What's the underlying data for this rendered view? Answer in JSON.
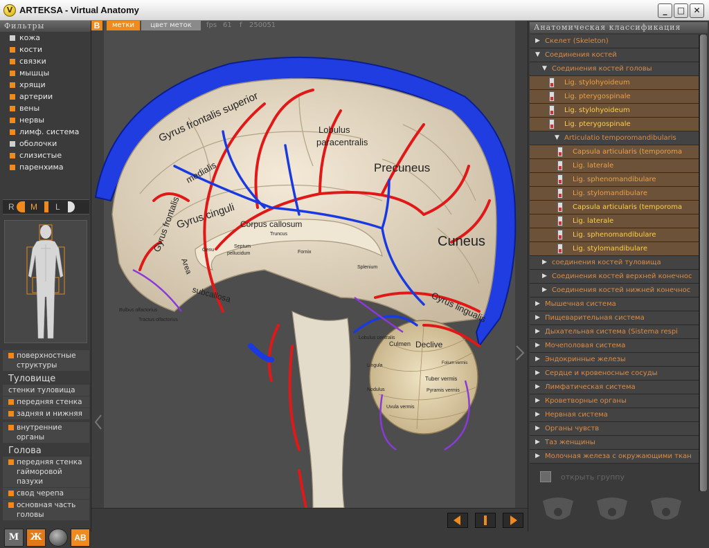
{
  "window": {
    "title": "ARTEKSA - Virtual Anatomy",
    "app_icon_glyph": "V",
    "buttons": {
      "minimize": "_",
      "maximize": "□",
      "close": "✕"
    }
  },
  "left": {
    "filters_header": "Фильтры",
    "filters": [
      {
        "label": "кожа",
        "color": "#cfcfcf"
      },
      {
        "label": "кости",
        "color": "#f08a1c"
      },
      {
        "label": "связки",
        "color": "#f08a1c"
      },
      {
        "label": "мышцы",
        "color": "#f08a1c"
      },
      {
        "label": "хрящи",
        "color": "#f08a1c"
      },
      {
        "label": "артерии",
        "color": "#f08a1c"
      },
      {
        "label": "вены",
        "color": "#f08a1c"
      },
      {
        "label": "нервы",
        "color": "#f08a1c"
      },
      {
        "label": "лимф. система",
        "color": "#f08a1c"
      },
      {
        "label": "оболочки",
        "color": "#cfcfcf"
      },
      {
        "label": "слизистые",
        "color": "#f08a1c"
      },
      {
        "label": "паренхима",
        "color": "#f08a1c"
      }
    ],
    "lod": {
      "r": "R",
      "m": "M",
      "l": "L"
    },
    "categories": {
      "surface": "поверхностные структуры",
      "torso_head": "Туловище",
      "torso": [
        "стенки туловища",
        "передняя стенка",
        "задняя и нижняя"
      ],
      "internal": "внутренние органы",
      "head_head": "Голова",
      "head": [
        "передняя стенка гайморовой пазухи",
        "свод черепа",
        "основная часть головы"
      ]
    },
    "bottom": {
      "m": "M",
      "zh": "Ж",
      "ab": "AB"
    }
  },
  "view": {
    "b_label": "B",
    "tab_labels": "метки",
    "tab_color": "цвет меток",
    "fps": "fps",
    "fps_value": "61",
    "f_label": "f",
    "f_value": "250051",
    "labels": {
      "gyrus_frontalis_superior": "Gyrus frontalis superior",
      "lobulus": "Lobulus",
      "paracentralis": "paracentralis",
      "precuneus": "Precuneus",
      "cuneus": "Cuneus",
      "gyrus_frontalis": "Gyrus frontalis",
      "medialis": "medialis",
      "gyrus_cinguli": "Gyrus cinguli",
      "corpus_callosum": "Corpus callosum",
      "truncus": "Truncus",
      "genu": "Genu",
      "septum": "Septum",
      "pellucidum": "pellucidum",
      "fornix": "Fornix",
      "splenium": "Splenium",
      "area": "Area",
      "subcallosa": "subcallosa",
      "gyrus_lingualis": "Gyrus lingualis",
      "culmen": "Culmen",
      "declive": "Declive",
      "lobulus_centralis": "Lobulus centralis",
      "lingula": "Lingula",
      "tuber_vermis": "Tuber vermis",
      "folium_vermis": "Folium vermis",
      "pyramis_vermis": "Pyramis vermis",
      "uvula_vermis": "Uvula vermis",
      "nodulus": "Nodulus",
      "bulbus_olfactorius": "Bulbus olfactorius",
      "tractus_olfactorius": "Tractus olfactorius"
    }
  },
  "right": {
    "header": "Анатомическая классификация",
    "tree": [
      {
        "label": "Скелет (Skeleton)",
        "depth": 0,
        "arrow": "right",
        "style": "normal"
      },
      {
        "label": "Соединения костей",
        "depth": 0,
        "arrow": "down",
        "style": "normal"
      },
      {
        "label": "Соединения костей головы",
        "depth": 1,
        "arrow": "down",
        "style": "normal"
      },
      {
        "label": "Lig. stylohyoideum",
        "depth": 2,
        "arrow": "badge",
        "style": "hl"
      },
      {
        "label": "Lig. pterygospinale",
        "depth": 2,
        "arrow": "badge",
        "style": "hl"
      },
      {
        "label": "Lig. stylohyoideum",
        "depth": 2,
        "arrow": "badge",
        "style": "hl2"
      },
      {
        "label": "Lig. pterygospinale",
        "depth": 2,
        "arrow": "badge",
        "style": "hl2"
      },
      {
        "label": "Articulatio temporomandibularis",
        "depth": 2,
        "arrow": "down",
        "style": "normal"
      },
      {
        "label": "Capsula articularis (temporoma",
        "depth": 3,
        "arrow": "badge",
        "style": "hl"
      },
      {
        "label": "Lig. laterale",
        "depth": 3,
        "arrow": "badge",
        "style": "hl"
      },
      {
        "label": "Lig. sphenomandibulare",
        "depth": 3,
        "arrow": "badge",
        "style": "hl"
      },
      {
        "label": "Lig. stylomandibulare",
        "depth": 3,
        "arrow": "badge",
        "style": "hl"
      },
      {
        "label": "Capsula articularis (temporoma",
        "depth": 3,
        "arrow": "badge",
        "style": "hl2"
      },
      {
        "label": "Lig. laterale",
        "depth": 3,
        "arrow": "badge",
        "style": "hl2"
      },
      {
        "label": "Lig. sphenomandibulare",
        "depth": 3,
        "arrow": "badge",
        "style": "hl2"
      },
      {
        "label": "Lig. stylomandibulare",
        "depth": 3,
        "arrow": "badge",
        "style": "hl2"
      },
      {
        "label": "соединения костей туловища",
        "depth": 1,
        "arrow": "right",
        "style": "normal"
      },
      {
        "label": "Соединения костей верхней конечнос",
        "depth": 1,
        "arrow": "right",
        "style": "normal"
      },
      {
        "label": "Соединения костей нижней конечнос",
        "depth": 1,
        "arrow": "right",
        "style": "normal"
      },
      {
        "label": "Мышечная система",
        "depth": 0,
        "arrow": "right",
        "style": "normal"
      },
      {
        "label": "Пищеварительная система",
        "depth": 0,
        "arrow": "right",
        "style": "normal"
      },
      {
        "label": "Дыхательная система    (Sistema respi",
        "depth": 0,
        "arrow": "right",
        "style": "normal"
      },
      {
        "label": "Мочеполовая система",
        "depth": 0,
        "arrow": "right",
        "style": "normal"
      },
      {
        "label": "Эндокринные железы",
        "depth": 0,
        "arrow": "right",
        "style": "normal"
      },
      {
        "label": "Сердце и кровеносные сосуды",
        "depth": 0,
        "arrow": "right",
        "style": "normal"
      },
      {
        "label": "Лимфатическая система",
        "depth": 0,
        "arrow": "right",
        "style": "normal"
      },
      {
        "label": "Кроветворные органы",
        "depth": 0,
        "arrow": "right",
        "style": "normal"
      },
      {
        "label": "Нервная система",
        "depth": 0,
        "arrow": "right",
        "style": "normal"
      },
      {
        "label": "Органы чувств",
        "depth": 0,
        "arrow": "right",
        "style": "normal"
      },
      {
        "label": "Таз женщины",
        "depth": 0,
        "arrow": "right",
        "style": "normal"
      },
      {
        "label": "Молочная железа с окружающими ткан",
        "depth": 0,
        "arrow": "right",
        "style": "normal"
      }
    ],
    "open_group": "открыть группу"
  },
  "colors": {
    "accent": "#f08a1c",
    "tree_text": "#e58a3a",
    "highlight_bg": "#6b5238",
    "highlight_text": "#ffd23a",
    "artery": "#e01818",
    "vein": "#1a3ae0"
  }
}
